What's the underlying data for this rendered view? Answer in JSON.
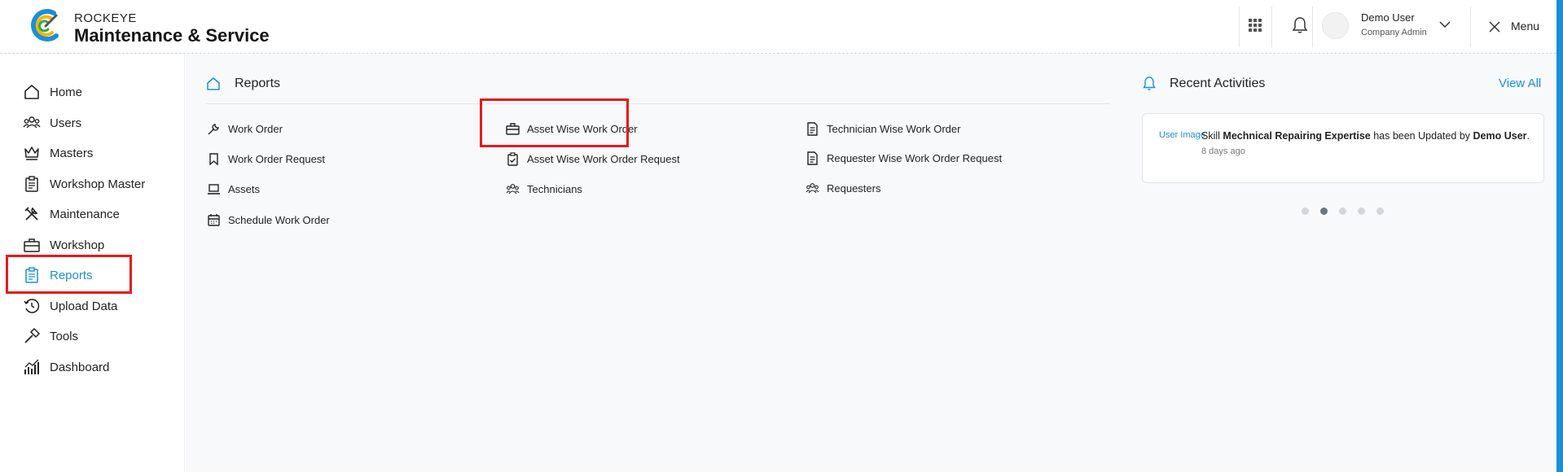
{
  "header": {
    "brand_top": "ROCKEYE",
    "brand_main": "Maintenance & Service",
    "user_name": "Demo User",
    "user_role": "Company Admin",
    "menu_label": "Menu"
  },
  "sidebar": {
    "items": [
      {
        "label": "Home",
        "icon": "home-icon"
      },
      {
        "label": "Users",
        "icon": "users-icon"
      },
      {
        "label": "Masters",
        "icon": "crown-icon"
      },
      {
        "label": "Workshop Master",
        "icon": "clipboard-icon"
      },
      {
        "label": "Maintenance",
        "icon": "tools-icon"
      },
      {
        "label": "Workshop",
        "icon": "briefcase-icon"
      },
      {
        "label": "Reports",
        "icon": "report-icon",
        "active": true
      },
      {
        "label": "Upload Data",
        "icon": "history-icon"
      },
      {
        "label": "Tools",
        "icon": "hammer-icon"
      },
      {
        "label": "Dashboard",
        "icon": "chart-icon"
      }
    ]
  },
  "reports": {
    "title": "Reports",
    "links": [
      {
        "label": "Work Order",
        "icon": "wrench-icon"
      },
      {
        "label": "Work Order Request",
        "icon": "bookmark-icon"
      },
      {
        "label": "Assets",
        "icon": "laptop-icon"
      },
      {
        "label": "Schedule Work Order",
        "icon": "calendar-icon"
      },
      {
        "label": "Asset Wise Work Order",
        "icon": "briefcase-icon"
      },
      {
        "label": "Asset Wise Work Order Request",
        "icon": "clipboard-check-icon"
      },
      {
        "label": "Technicians",
        "icon": "users-icon"
      },
      {
        "label": "Technician Wise Work Order",
        "icon": "document-icon"
      },
      {
        "label": "Requester Wise Work Order Request",
        "icon": "document-icon"
      },
      {
        "label": "Requesters",
        "icon": "users-icon"
      }
    ]
  },
  "activities": {
    "title": "Recent Activities",
    "view_all": "View All",
    "item": {
      "img_alt": "User Image",
      "prefix": "Skill ",
      "subject": "Mechnical Repairing Expertise",
      "middle": " has been Updated by ",
      "actor": "Demo User",
      "suffix": ".",
      "time": "8 days ago"
    },
    "dots_count": 5,
    "active_dot": 1
  },
  "colors": {
    "accent": "#1b8fd6",
    "highlight": "#e51b1b"
  }
}
